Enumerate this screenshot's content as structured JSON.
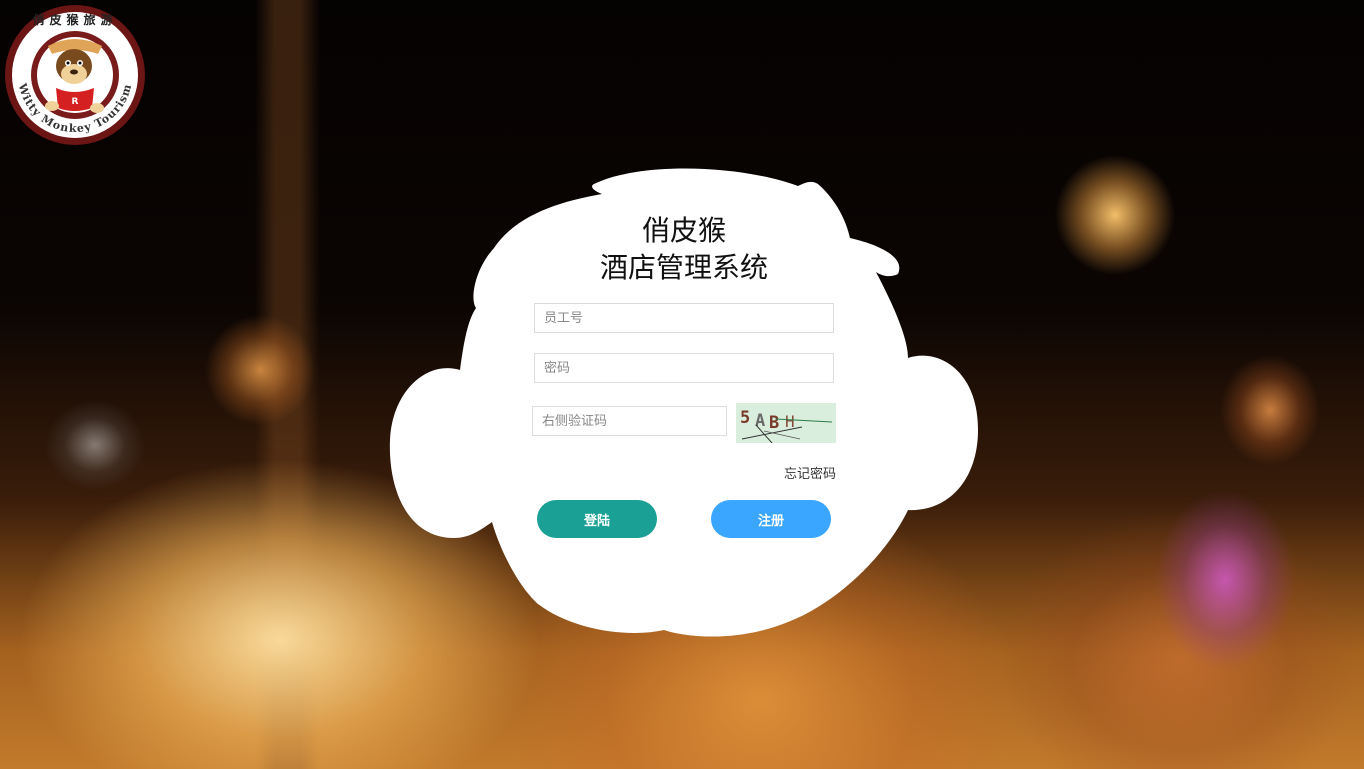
{
  "logo": {
    "top_text": "俏皮猴旅游",
    "ring_text": "Witty Monkey Tourism",
    "badge_letter": "R"
  },
  "login": {
    "title_line1": "俏皮猴",
    "title_line2": "酒店管理系统",
    "employee_placeholder": "员工号",
    "password_placeholder": "密码",
    "captcha_placeholder": "右侧验证码",
    "captcha_code": [
      "5",
      "A",
      "B",
      "H"
    ],
    "forgot_label": "忘记密码",
    "login_label": "登陆",
    "register_label": "注册"
  },
  "colors": {
    "login_button": "#1aa094",
    "register_button": "#3aa6ff",
    "captcha_bg": "#d9eedc",
    "logo_ring": "#6b1515"
  }
}
